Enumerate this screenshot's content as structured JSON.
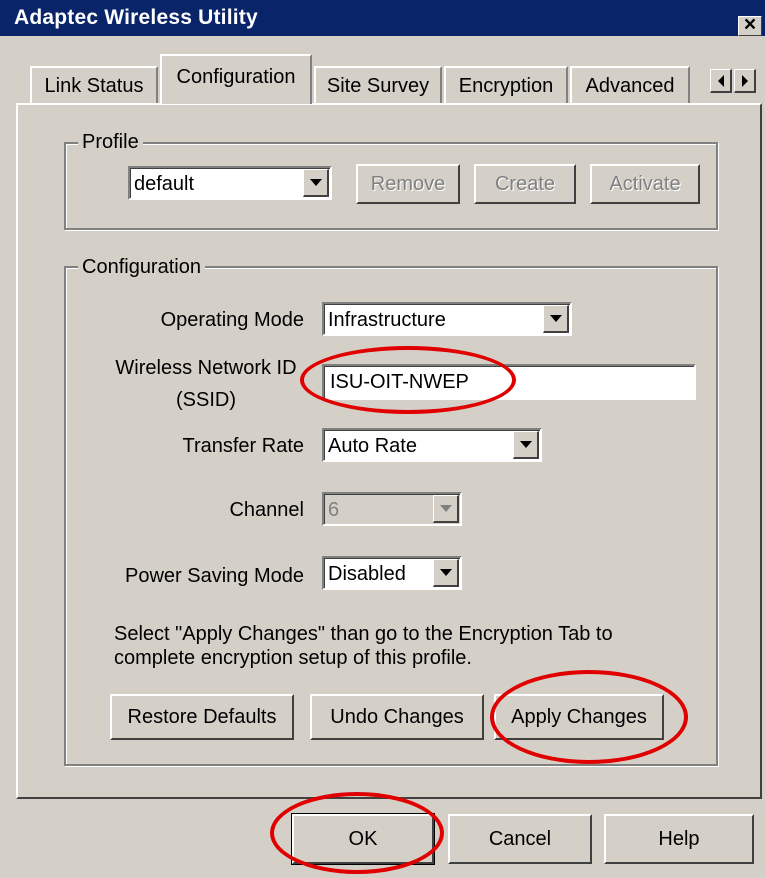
{
  "window": {
    "title": "Adaptec Wireless Utility",
    "close_label": "×"
  },
  "tabs": [
    {
      "label": "Link Status",
      "active": false
    },
    {
      "label": "Configuration",
      "active": true
    },
    {
      "label": "Site Survey",
      "active": false
    },
    {
      "label": "Encryption",
      "active": false
    },
    {
      "label": "Advanced",
      "active": false
    }
  ],
  "tab_scroll": {
    "left_icon": "arrow-left-icon",
    "right_icon": "arrow-right-icon"
  },
  "profile": {
    "group_title": "Profile",
    "selected": "default",
    "remove_label": "Remove",
    "create_label": "Create",
    "activate_label": "Activate"
  },
  "configuration": {
    "group_title": "Configuration",
    "operating_mode_label": "Operating Mode",
    "operating_mode_value": "Infrastructure",
    "ssid_label_line1": "Wireless Network ID",
    "ssid_label_line2": "(SSID)",
    "ssid_value": "ISU-OIT-NWEP",
    "transfer_rate_label": "Transfer Rate",
    "transfer_rate_value": "Auto Rate",
    "channel_label": "Channel",
    "channel_value": "6",
    "power_saving_label": "Power Saving Mode",
    "power_saving_value": "Disabled",
    "note_line1": "Select \"Apply Changes\" than go to the Encryption Tab to",
    "note_line2": "complete encryption setup of  this profile.",
    "restore_defaults_label": "Restore Defaults",
    "undo_changes_label": "Undo Changes",
    "apply_changes_label": "Apply Changes"
  },
  "footer": {
    "ok_label": "OK",
    "cancel_label": "Cancel",
    "help_label": "Help"
  },
  "colors": {
    "titlebar": "#0a246a",
    "face": "#d4d0c8",
    "highlight_circle": "#e00000"
  }
}
